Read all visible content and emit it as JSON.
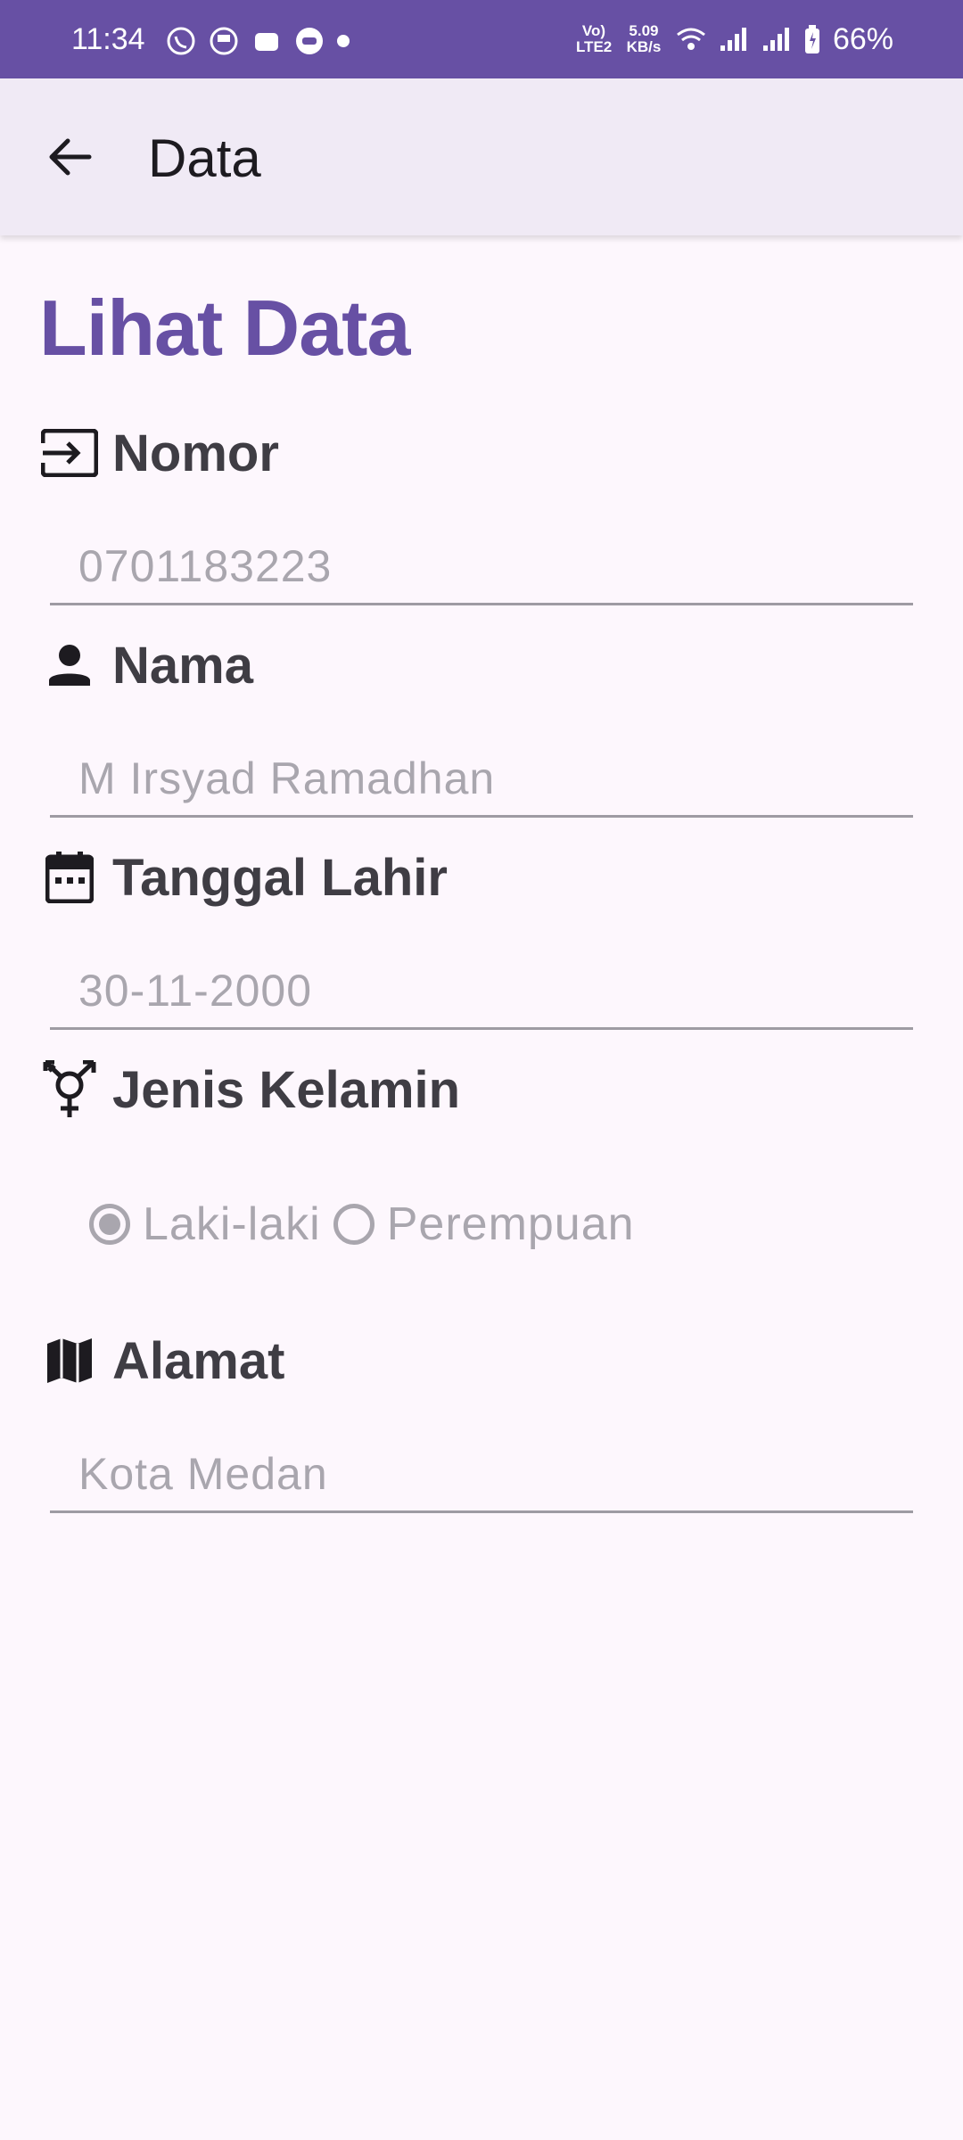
{
  "status_bar": {
    "time": "11:34",
    "network_type": "Vo) LTE2",
    "speed": "5.09 KB/s",
    "battery": "66%",
    "app_icons": [
      "whatsapp-icon",
      "app-icon",
      "wallet-icon",
      "chat-icon",
      "dot-icon"
    ]
  },
  "app_bar": {
    "title": "Data"
  },
  "page": {
    "title": "Lihat Data"
  },
  "fields": {
    "nomor": {
      "label": "Nomor",
      "value": "0701183223",
      "icon": "input-icon"
    },
    "nama": {
      "label": "Nama",
      "value": "M Irsyad Ramadhan",
      "icon": "person-icon"
    },
    "tanggal_lahir": {
      "label": "Tanggal Lahir",
      "value": "30-11-2000",
      "icon": "calendar-icon"
    },
    "jenis_kelamin": {
      "label": "Jenis Kelamin",
      "icon": "gender-icon",
      "options": [
        "Laki-laki",
        "Perempuan"
      ],
      "selected": "Laki-laki"
    },
    "alamat": {
      "label": "Alamat",
      "value": "Kota Medan",
      "icon": "map-icon"
    }
  },
  "colors": {
    "primary": "#6750a4",
    "background": "#fdf7fd",
    "app_bar": "#f0eaf5",
    "disabled_text": "#a9a6ae"
  }
}
